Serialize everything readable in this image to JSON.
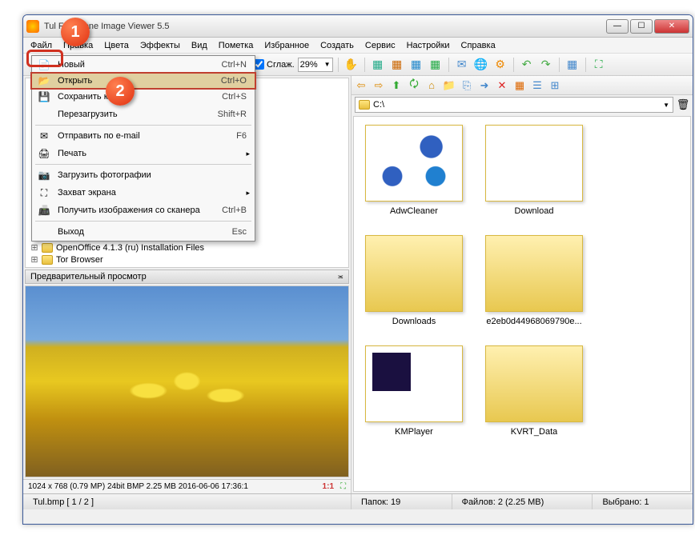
{
  "title": "Tul           FastStone Image Viewer 5.5",
  "menubar": [
    "Файл",
    "Правка",
    "Цвета",
    "Эффекты",
    "Вид",
    "Пометка",
    "Избранное",
    "Создать",
    "Сервис",
    "Настройки",
    "Справка"
  ],
  "toolbar1": {
    "smooth_label": "Сглаж.",
    "zoom": "29%"
  },
  "dropdown": {
    "items": [
      {
        "icon": "📄",
        "label": "Новый",
        "shortcut": "Ctrl+N"
      },
      {
        "icon": "📂",
        "label": "Открыть",
        "shortcut": "Ctrl+O",
        "highlight": true
      },
      {
        "icon": "💾",
        "label": "Сохранить как...",
        "shortcut": "Ctrl+S"
      },
      {
        "icon": "",
        "label": "Перезагрузить",
        "shortcut": "Shift+R"
      },
      {
        "sep": true
      },
      {
        "icon": "✉",
        "label": "Отправить по e-mail",
        "shortcut": "F6"
      },
      {
        "icon": "🖨",
        "label": "Печать",
        "shortcut": "",
        "arrow": true
      },
      {
        "sep": true
      },
      {
        "icon": "📷",
        "label": "Загрузить фотографии",
        "shortcut": ""
      },
      {
        "icon": "⛶",
        "label": "Захват экрана",
        "shortcut": "",
        "arrow": true
      },
      {
        "icon": "📠",
        "label": "Получить изображения со сканера",
        "shortcut": "Ctrl+B"
      },
      {
        "sep": true
      },
      {
        "icon": "",
        "label": "Выход",
        "shortcut": "Esc"
      }
    ]
  },
  "tree": [
    {
      "label": "OpenOffice 4.1.3 (ru) Installation Files"
    },
    {
      "label": "Tor Browser"
    }
  ],
  "preview": {
    "header": "Предварительный просмотр",
    "status": "1024 x 768 (0.79 MP)  24bit  BMP   2.25 MB   2016-06-06 17:36:1",
    "scale": "1:1"
  },
  "addr": "C:\\",
  "thumbs": [
    {
      "label": "AdwCleaner",
      "cls": "adw"
    },
    {
      "label": "Download",
      "cls": "dl"
    },
    {
      "label": "Downloads",
      "cls": ""
    },
    {
      "label": "e2eb0d44968069790e...",
      "cls": ""
    },
    {
      "label": "KMPlayer",
      "cls": "km"
    },
    {
      "label": "KVRT_Data",
      "cls": ""
    }
  ],
  "status": {
    "file": "Tul.bmp [ 1 / 2 ]",
    "folders": "Папок: 19",
    "files": "Файлов: 2 (2.25 MB)",
    "selected": "Выбрано: 1"
  },
  "callouts": {
    "c1": "1",
    "c2": "2"
  }
}
